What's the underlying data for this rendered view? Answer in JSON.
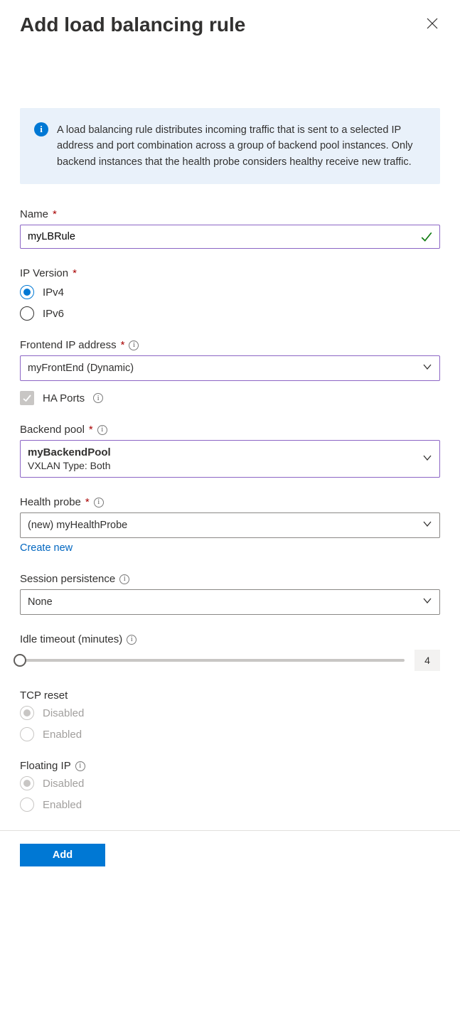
{
  "header": {
    "title": "Add load balancing rule"
  },
  "info": {
    "text": "A load balancing rule distributes incoming traffic that is sent to a selected IP address and port combination across a group of backend pool instances. Only backend instances that the health probe considers healthy receive new traffic."
  },
  "name_field": {
    "label": "Name",
    "value": "myLBRule"
  },
  "ip_version": {
    "label": "IP Version",
    "options": {
      "v4": "IPv4",
      "v6": "IPv6"
    }
  },
  "frontend_ip": {
    "label": "Frontend IP address",
    "value": "myFrontEnd (Dynamic)"
  },
  "ha_ports": {
    "label": "HA Ports"
  },
  "backend_pool": {
    "label": "Backend pool",
    "value_primary": "myBackendPool",
    "value_secondary": "VXLAN Type: Both"
  },
  "health_probe": {
    "label": "Health probe",
    "value": "(new) myHealthProbe",
    "create_new": "Create new"
  },
  "session_persistence": {
    "label": "Session persistence",
    "value": "None"
  },
  "idle_timeout": {
    "label": "Idle timeout (minutes)",
    "value": "4"
  },
  "tcp_reset": {
    "label": "TCP reset",
    "options": {
      "disabled": "Disabled",
      "enabled": "Enabled"
    }
  },
  "floating_ip": {
    "label": "Floating IP",
    "options": {
      "disabled": "Disabled",
      "enabled": "Enabled"
    }
  },
  "footer": {
    "add": "Add"
  }
}
